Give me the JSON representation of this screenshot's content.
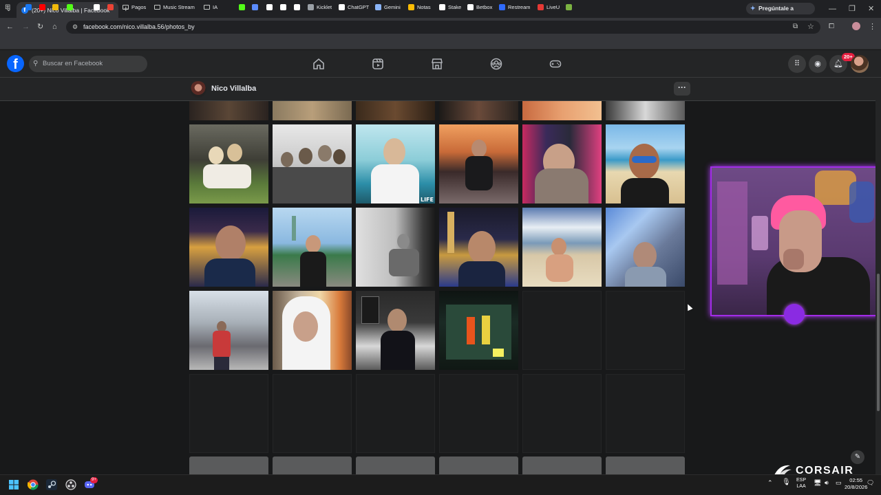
{
  "browser": {
    "tab": {
      "title": "(20+) Nico Villalba | Facebook",
      "favicon": "facebook-icon"
    },
    "new_tab_symbol": "+",
    "gemini_button": "Pregúntale a Gemini",
    "url": "facebook.com/nico.villalba.56/photos_by",
    "bookmarks": [
      {
        "label": "",
        "icon": "facebook-icon",
        "color": "#1877f2"
      },
      {
        "label": "",
        "icon": "youtube-icon",
        "color": "#ff0000"
      },
      {
        "label": "",
        "icon": "binance-icon",
        "color": "#f0b90b"
      },
      {
        "label": "",
        "icon": "kick-icon",
        "color": "#53fc18"
      },
      {
        "label": "",
        "icon": "patreon-icon",
        "color": "#ffffff"
      },
      {
        "label": "",
        "icon": "gmail-icon",
        "color": "#ea4335"
      },
      {
        "label": "Pagos",
        "icon": "folder-icon"
      },
      {
        "label": "Music Stream",
        "icon": "folder-icon"
      },
      {
        "label": "IA",
        "icon": "folder-icon"
      },
      {
        "label": "",
        "icon": "kick-icon",
        "color": "#53fc18"
      },
      {
        "label": "",
        "icon": "loop-icon",
        "color": "#5b8cff"
      },
      {
        "label": "",
        "icon": "tiktok-icon",
        "color": "#ffffff"
      },
      {
        "label": "",
        "icon": "v-icon",
        "color": "#ffffff"
      },
      {
        "label": "",
        "icon": "diamond-icon",
        "color": "#ffffff"
      },
      {
        "label": "Kicklet",
        "icon": "kicklet-icon",
        "color": "#9aa0a6"
      },
      {
        "label": "ChatGPT",
        "icon": "chatgpt-icon",
        "color": "#ffffff"
      },
      {
        "label": "Gemini",
        "icon": "gemini-icon",
        "color": "#8ab4f8"
      },
      {
        "label": "Notas",
        "icon": "bulb-icon",
        "color": "#fbbc04"
      },
      {
        "label": "Stake",
        "icon": "stake-icon",
        "color": "#ffffff"
      },
      {
        "label": "Betbox",
        "icon": "betbox-icon",
        "color": "#ffffff"
      },
      {
        "label": "Restream",
        "icon": "restream-icon",
        "color": "#2f6bff"
      },
      {
        "label": "LiveU",
        "icon": "liveu-icon",
        "color": "#e53935"
      },
      {
        "label": "",
        "icon": "check-icon",
        "color": "#7cb342"
      }
    ]
  },
  "facebook": {
    "search_placeholder": "Buscar en Facebook",
    "notifications_count": "20+",
    "profile_name": "Nico Villalba",
    "more_symbol": "···",
    "photo_tags": {
      "life": "LIFE"
    }
  },
  "stream_overlay": {
    "brand": "CORSAIR"
  },
  "taskbar": {
    "lang_top": "ESP",
    "lang_bottom": "LAA",
    "time": "02:55",
    "date": "20/8/2026",
    "discord_badge": "9+"
  },
  "colors": {
    "fb_blue": "#0866ff",
    "notification_red": "#e41e3f",
    "stream_purple": "#a22ce8"
  }
}
